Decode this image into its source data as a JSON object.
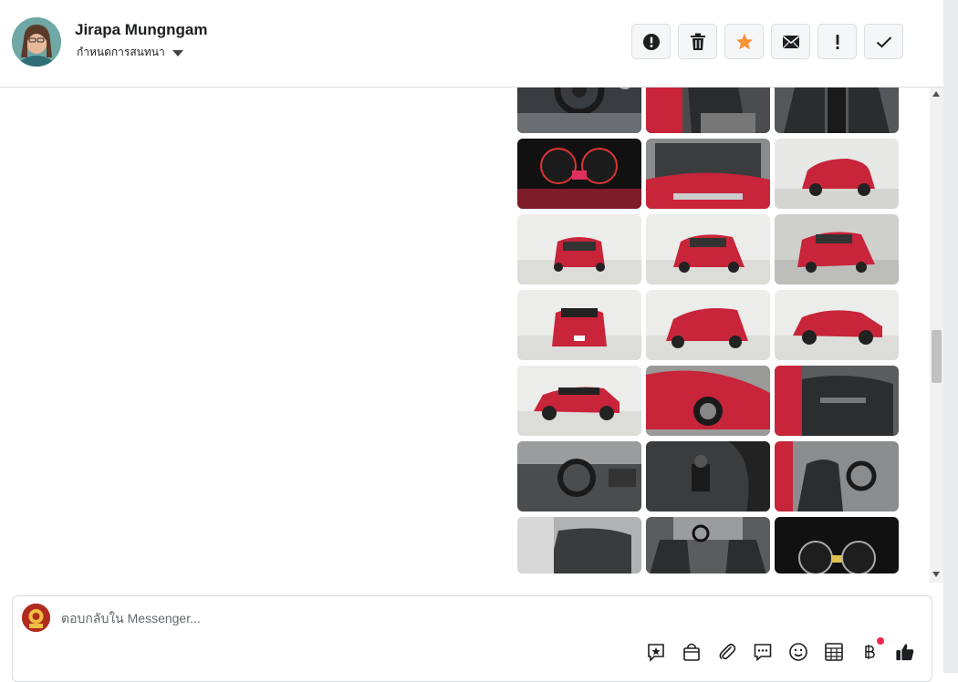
{
  "header": {
    "contact_name": "Jirapa Mungngam",
    "assign_label": "กำหนดการสนทนา",
    "actions": [
      {
        "name": "report-spam-button",
        "icon": "alert-circle-icon"
      },
      {
        "name": "delete-button",
        "icon": "trash-icon"
      },
      {
        "name": "star-button",
        "icon": "star-icon"
      },
      {
        "name": "mark-unread-button",
        "icon": "envelope-icon"
      },
      {
        "name": "important-button",
        "icon": "exclamation-icon"
      },
      {
        "name": "mark-done-button",
        "icon": "check-icon"
      }
    ]
  },
  "gallery": {
    "images": [
      "car-interior-steering",
      "car-interior-seats",
      "car-interior-console",
      "car-gauge-cluster",
      "car-engine-bay",
      "car-front-three-quarter",
      "car-front-view",
      "car-front-three-quarter-2",
      "car-rear-three-quarter",
      "car-rear-view",
      "car-front-three-quarter-3",
      "car-side-front",
      "car-side-view",
      "car-wheel-closeup",
      "car-door-panel",
      "car-dashboard",
      "car-gear-shifter",
      "car-front-seats",
      "car-rear-seats",
      "car-cabin-overview",
      "car-gauge-cluster-2"
    ]
  },
  "composer": {
    "placeholder": "ตอบกลับใน Messenger...",
    "tools": [
      {
        "name": "saved-reply-icon"
      },
      {
        "name": "shop-bag-icon"
      },
      {
        "name": "attachment-icon"
      },
      {
        "name": "chat-bubble-icon"
      },
      {
        "name": "emoji-icon"
      },
      {
        "name": "table-icon"
      },
      {
        "name": "baht-payment-icon",
        "badge": true
      },
      {
        "name": "thumbs-up-icon"
      }
    ]
  },
  "colors": {
    "accent_star": "#f7923b",
    "icon_dark": "#1c1e21",
    "badge": "#f02849",
    "car_red": "#c8243a"
  }
}
